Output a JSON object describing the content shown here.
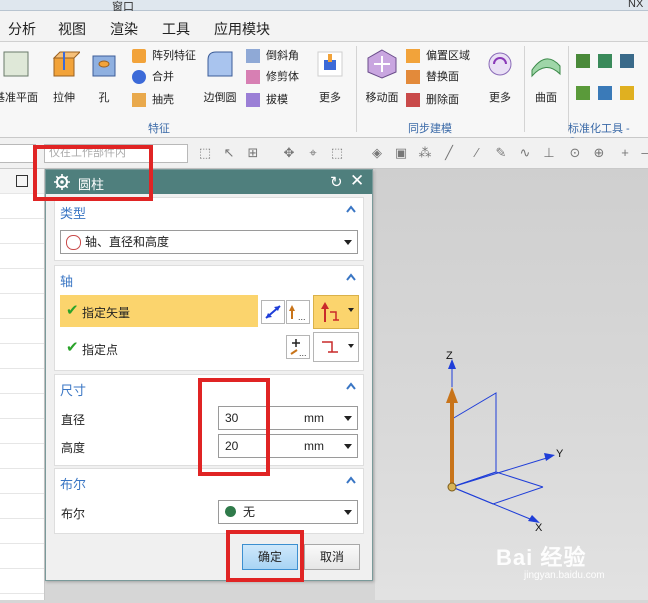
{
  "app": {
    "title_fragment": "NX",
    "top_chip": "窗口"
  },
  "menubar": {
    "items": [
      "分析",
      "视图",
      "渲染",
      "工具",
      "应用模块"
    ]
  },
  "ribbon": {
    "big_buttons": [
      "基准平面",
      "拉伸",
      "孔",
      "边倒圆",
      "更多",
      "移动面",
      "更多",
      "曲面"
    ],
    "feature_small": [
      "阵列特征",
      "合并",
      "抽壳"
    ],
    "detail_small": [
      "倒斜角",
      "修剪体",
      "拔模"
    ],
    "sync_small": [
      "偏置区域",
      "替换面",
      "删除面"
    ],
    "groups": [
      "特征",
      "同步建模",
      "标准化工具 - G..."
    ]
  },
  "toolbar": {
    "filter_combo": "仅在工作部件内"
  },
  "dialog": {
    "title": "圆柱",
    "type_section": {
      "header": "类型",
      "selected": "轴、直径和高度"
    },
    "axis_section": {
      "header": "轴",
      "specify_vector": "指定矢量",
      "specify_point": "指定点"
    },
    "size_section": {
      "header": "尺寸",
      "diameter_label": "直径",
      "diameter_value": "30",
      "diameter_unit": "mm",
      "height_label": "高度",
      "height_value": "20",
      "height_unit": "mm"
    },
    "boolean_section": {
      "header": "布尔",
      "label": "布尔",
      "selected": "无"
    },
    "ok_label": "确定",
    "cancel_label": "取消"
  },
  "viewport": {
    "axis_z": "Z",
    "axis_y": "Y",
    "axis_x": "X"
  },
  "watermark": {
    "brand": "Bai 经验",
    "url": "jingyan.baidu.com"
  },
  "colors": {
    "dialog_title_bg": "#4f7f7d",
    "section_header": "#3a76c4",
    "highlight_red": "#e02424",
    "selected_row": "#fbd46d",
    "check_green": "#2aa32a"
  }
}
